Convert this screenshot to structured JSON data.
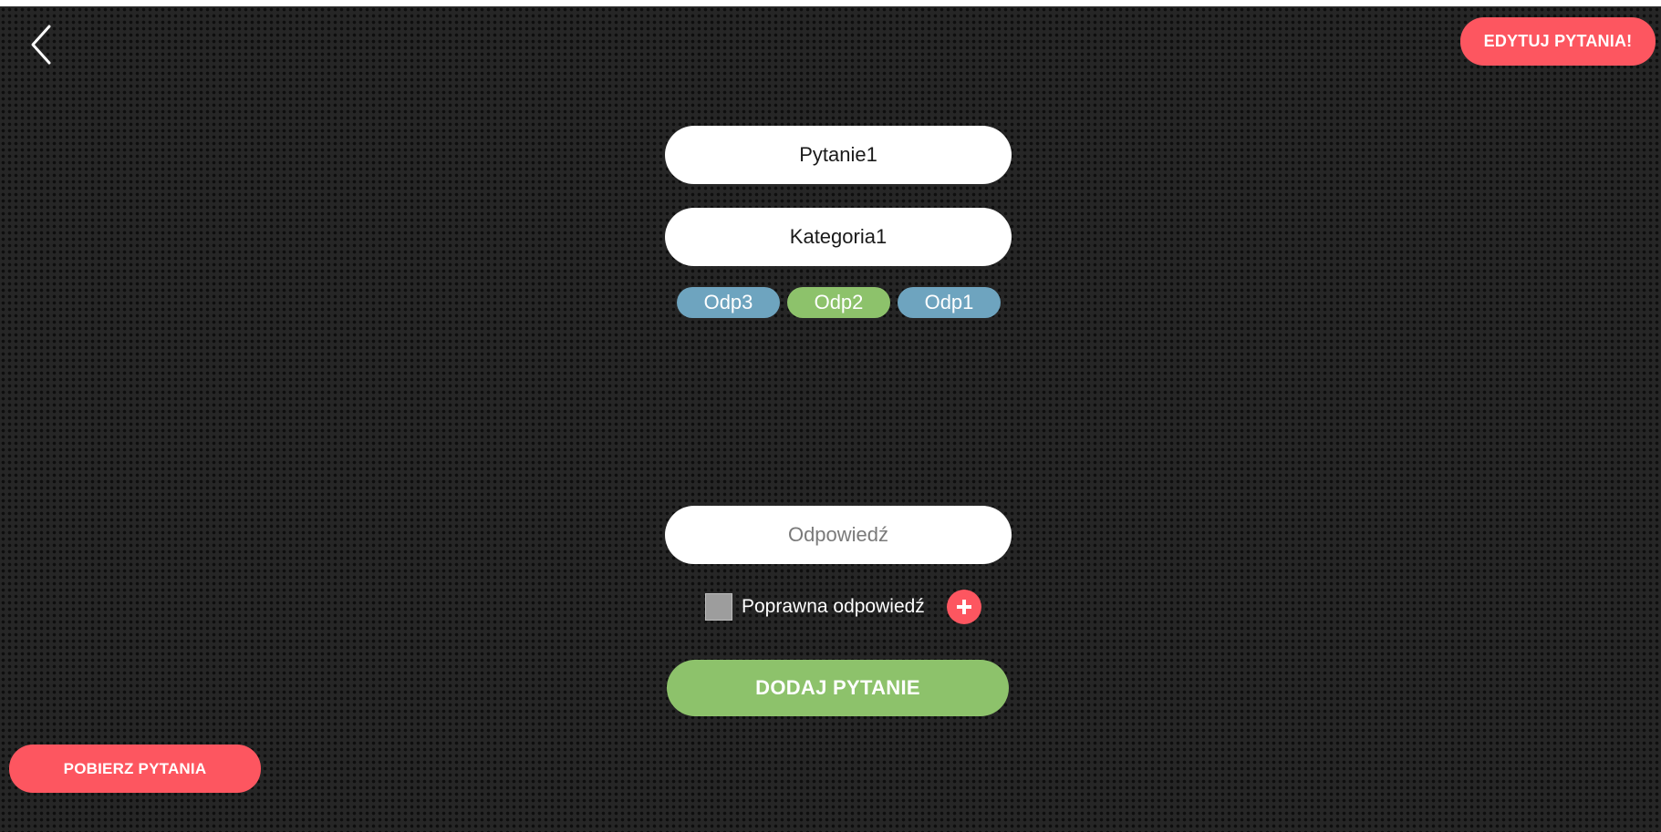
{
  "header": {
    "back_icon": "chevron-left-icon",
    "edit_label": "EDYTUJ PYTANIA!"
  },
  "form": {
    "question_value": "Pytanie1",
    "category_value": "Kategoria1",
    "answers": [
      {
        "label": "Odp3",
        "correct": false,
        "color": "#6ea4bf"
      },
      {
        "label": "Odp2",
        "correct": true,
        "color": "#8dc26b"
      },
      {
        "label": "Odp1",
        "correct": false,
        "color": "#6ea4bf"
      }
    ],
    "answer_placeholder": "Odpowiedź",
    "correct_label": "Poprawna odpowiedź",
    "correct_checked": false,
    "add_icon": "plus-icon",
    "submit_label": "DODAJ PYTANIE"
  },
  "footer": {
    "fetch_label": "POBIERZ PYTANIA"
  },
  "colors": {
    "accent_red": "#fd5660",
    "accent_green": "#8dc26b",
    "accent_blue": "#6ea4bf",
    "background": "#262626"
  }
}
